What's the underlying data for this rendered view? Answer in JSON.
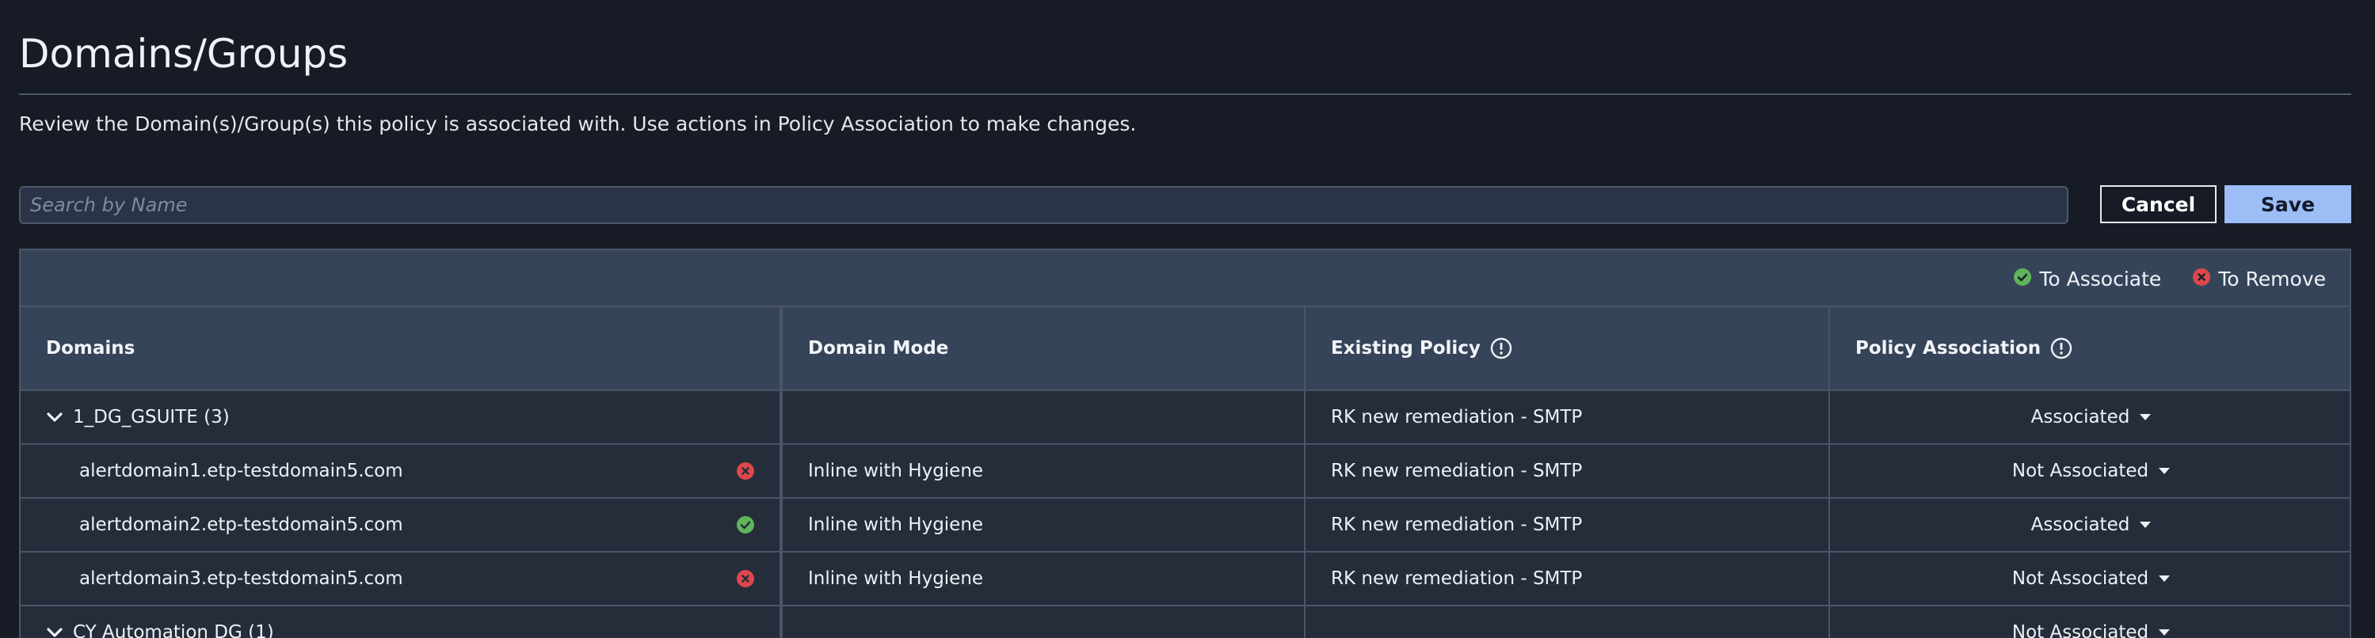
{
  "page": {
    "title": "Domains/Groups",
    "description": "Review the Domain(s)/Group(s) this policy is associated with. Use actions in Policy Association to make changes."
  },
  "search": {
    "placeholder": "Search by Name",
    "value": ""
  },
  "actions": {
    "cancel_label": "Cancel",
    "save_label": "Save"
  },
  "legend": {
    "associate_label": "To Associate",
    "remove_label": "To Remove"
  },
  "colors": {
    "associate": "#5fb55a",
    "remove": "#e0474c",
    "save_button": "#9cbdf6"
  },
  "table": {
    "headers": {
      "domains": "Domains",
      "domain_mode": "Domain Mode",
      "existing_policy": "Existing Policy",
      "policy_association": "Policy Association"
    },
    "rows": [
      {
        "type": "group",
        "name": "1_DG_GSUITE (3)",
        "mode": "",
        "policy": "RK new remediation - SMTP",
        "association": "Associated",
        "status": ""
      },
      {
        "type": "domain",
        "name": "alertdomain1.etp-testdomain5.com",
        "mode": "Inline with Hygiene",
        "policy": "RK new remediation - SMTP",
        "association": "Not Associated",
        "status": "remove"
      },
      {
        "type": "domain",
        "name": "alertdomain2.etp-testdomain5.com",
        "mode": "Inline with Hygiene",
        "policy": "RK new remediation - SMTP",
        "association": "Associated",
        "status": "associate"
      },
      {
        "type": "domain",
        "name": "alertdomain3.etp-testdomain5.com",
        "mode": "Inline with Hygiene",
        "policy": "RK new remediation - SMTP",
        "association": "Not Associated",
        "status": "remove"
      },
      {
        "type": "group",
        "name": "CY Automation DG (1)",
        "mode": "",
        "policy": "",
        "association": "Not Associated",
        "status": ""
      }
    ]
  }
}
